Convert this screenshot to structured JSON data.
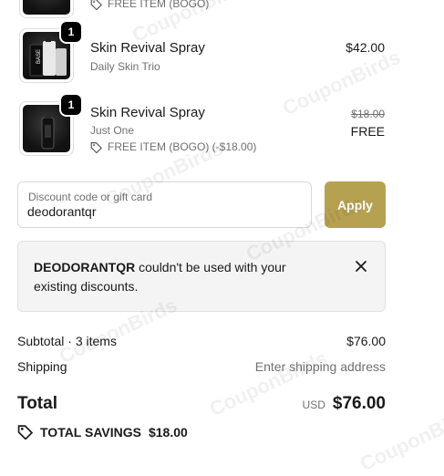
{
  "items": [
    {
      "free_label": "FREE ITEM (BOGO)"
    },
    {
      "name": "Skin Revival Spray",
      "variant": "Daily Skin Trio",
      "price": "$42.00",
      "quantity": "1"
    },
    {
      "name": "Skin Revival Spray",
      "variant": "Just One",
      "free_label": "FREE ITEM (BOGO) (-$18.00)",
      "original_price": "$18.00",
      "price": "FREE",
      "quantity": "1"
    }
  ],
  "discount": {
    "label": "Discount code or gift card",
    "value": "deodorantqr",
    "apply_label": "Apply"
  },
  "alert": {
    "code": "DEODORANTQR",
    "message": " couldn't be used with your existing discounts."
  },
  "summary": {
    "subtotal_label": "Subtotal · 3 items",
    "subtotal_value": "$76.00",
    "shipping_label": "Shipping",
    "shipping_value": "Enter shipping address",
    "total_label": "Total",
    "currency": "USD",
    "total_value": "$76.00",
    "savings_label": "TOTAL SAVINGS",
    "savings_value": "$18.00"
  },
  "watermark": "CouponBirds",
  "colors": {
    "apply_button": "#b6a150",
    "alert_bg": "#f4f4f4",
    "badge": "#000000"
  }
}
